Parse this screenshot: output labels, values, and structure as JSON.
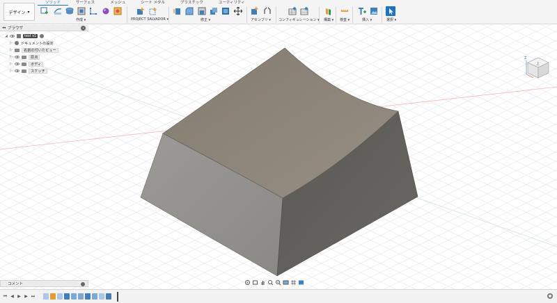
{
  "workspace": {
    "label": "デザイン",
    "caret": "▾"
  },
  "tabs": [
    "ソリッド",
    "サーフェス",
    "メッシュ",
    "シート メタル",
    "プラスチック",
    "ユーティリティ"
  ],
  "active_tab": "ソリッド",
  "toolbar_groups": {
    "create": "作成 ▾",
    "project": "PROJECT SALVADOR ▾",
    "modify": "修正 ▾",
    "assemble": "アセンブリ ▾",
    "configure": "コンフィギュレーション ▾",
    "construct": "構築 ▾",
    "inspect": "検査 ▾",
    "insert": "挿入 ▾",
    "select": "選択 ▾"
  },
  "browser": {
    "title": "ブラウザ",
    "root": "test v1",
    "items": [
      {
        "label": "ドキュメントの設定",
        "kind": "settings"
      },
      {
        "label": "名前の付いたビュー",
        "kind": "folder"
      },
      {
        "label": "原点",
        "kind": "folder"
      },
      {
        "label": "ボディ",
        "kind": "folder"
      },
      {
        "label": "スケッチ",
        "kind": "folder"
      }
    ]
  },
  "comments": {
    "label": "コメント"
  },
  "viewcube": {
    "face_label": "上",
    "axis_z": "Z"
  },
  "colors": {
    "accent": "#1a73c9",
    "body_top": "#8b8174",
    "body_left": "#8f8e8a",
    "body_right": "#5d5b56",
    "toolbar_bg": "#f4f4f4"
  },
  "icons": {
    "navbar": [
      "orbit-icon",
      "look-at-icon",
      "pan-icon",
      "zoom-icon",
      "fit-icon",
      "display-settings-icon",
      "grid-icon",
      "viewports-icon"
    ],
    "timeline_controls": [
      "first-icon",
      "previous-icon",
      "play-icon",
      "next-icon",
      "last-icon"
    ]
  }
}
